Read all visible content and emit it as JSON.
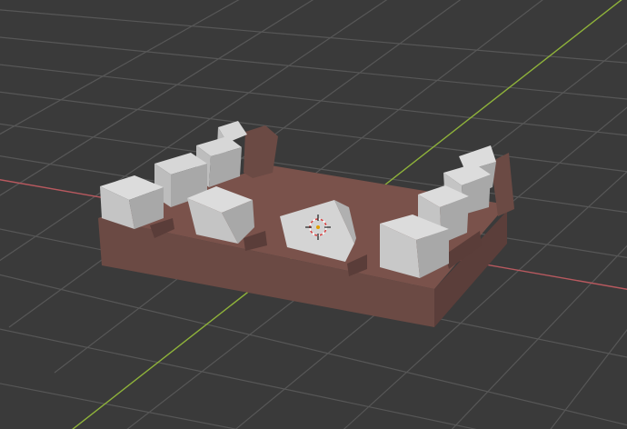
{
  "viewport": {
    "background_color": "#3a3a3a",
    "grid_color": "#575757",
    "x_axis_color": "#b8595f",
    "y_axis_color": "#8fb33a"
  },
  "scene": {
    "base_color": "#6b4a44",
    "base_top_color": "#7a524b",
    "cube_light": "#d7d7d7",
    "cube_mid": "#bdbdbd",
    "cube_dark": "#9a9a9a"
  },
  "icons": {
    "origin_cursor": "3d-cursor-icon"
  }
}
